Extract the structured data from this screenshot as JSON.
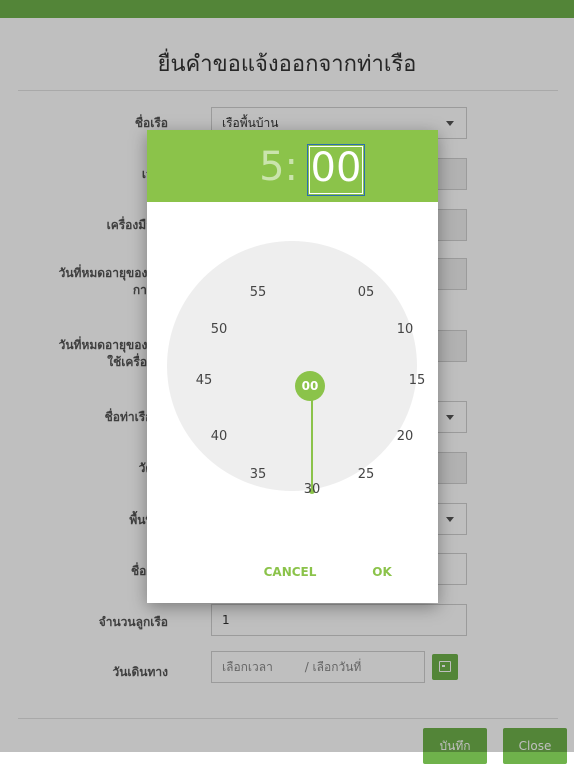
{
  "page": {
    "title": "ยื่นคำขอแจ้งออกจากท่าเรือ"
  },
  "form": {
    "boat_name_label": "ชื่อเรือ",
    "boat_name_value": "เรือพื้นบ้าน",
    "owner_label": "เจ้าข",
    "fishing_gear_label": "เครื่องมือทำ",
    "license_expiry_label_1": "วันที่หมดอายุของใบอ",
    "license_expiry_label_2": "การทำ",
    "gear_license_expiry_label_1": "วันที่หมดอายุของใบอ",
    "gear_license_expiry_label_2": "ใช้เครื่องมือ",
    "port_name_label": "ชื่อท่าเรือที่แ",
    "purpose_label": "วัตถุป",
    "area_label": "พื้นที่ทำ",
    "captain_label": "ชื่อผู้ทำ",
    "crew_count_label": "จำนวนลูกเรือ",
    "crew_count_value": "1",
    "departure_label": "วันเดินทาง",
    "time_placeholder": "เลือกเวลา",
    "date_placeholder": "/ เลือกวันที่"
  },
  "footer": {
    "save_label": "บันทึก",
    "close_label": "Close"
  },
  "picker": {
    "hour": "5",
    "separator": ":",
    "minute": "00",
    "selected": "00",
    "dial": [
      "05",
      "10",
      "15",
      "20",
      "25",
      "30",
      "35",
      "40",
      "45",
      "50",
      "55"
    ],
    "cancel_label": "CANCEL",
    "ok_label": "OK"
  },
  "colors": {
    "accent": "#8bc34a",
    "brand": "#6fb24b"
  }
}
